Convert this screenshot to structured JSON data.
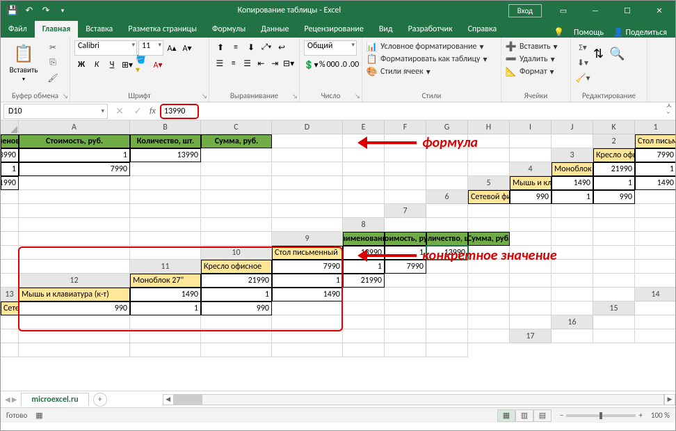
{
  "title": "Копирование таблицы  -  Excel",
  "account": "Вход",
  "tabs": [
    "Файл",
    "Главная",
    "Вставка",
    "Разметка страницы",
    "Формулы",
    "Данные",
    "Рецензирование",
    "Вид",
    "Разработчик",
    "Справка"
  ],
  "help": {
    "help": "Помощь",
    "share": "Поделиться"
  },
  "ribbon": {
    "clipboard": {
      "label": "Буфер обмена",
      "paste": "Вставить"
    },
    "font": {
      "label": "Шрифт",
      "name": "Calibri",
      "size": "11",
      "bold": "Ж",
      "italic": "К",
      "underline": "Ч"
    },
    "align": {
      "label": "Выравнивание"
    },
    "number": {
      "label": "Число",
      "format": "Общий"
    },
    "styles": {
      "label": "Стили",
      "cond": "Условное форматирование",
      "table": "Форматировать как таблицу",
      "cell": "Стили ячеек"
    },
    "cells": {
      "label": "Ячейки",
      "insert": "Вставить",
      "delete": "Удалить",
      "format": "Формат"
    },
    "edit": {
      "label": "Редактирование"
    }
  },
  "name_box": "D10",
  "formula_value": "13990",
  "columns": [
    "A",
    "B",
    "C",
    "D",
    "E",
    "F",
    "G",
    "H",
    "I",
    "J",
    "K"
  ],
  "rows": [
    "1",
    "2",
    "3",
    "4",
    "5",
    "6",
    "7",
    "8",
    "9",
    "10",
    "11",
    "12",
    "13",
    "14",
    "15",
    "16",
    "17"
  ],
  "headers": {
    "name": "Наименование",
    "cost": "Стоимость, руб.",
    "qty": "Количество, шт.",
    "sum": "Сумма, руб."
  },
  "data": [
    {
      "name": "Стол письменный",
      "cost": "13990",
      "qty": "1",
      "sum": "13990"
    },
    {
      "name": "Кресло офисное",
      "cost": "7990",
      "qty": "1",
      "sum": "7990"
    },
    {
      "name": "Моноблок 27\"",
      "cost": "21990",
      "qty": "1",
      "sum": "21990"
    },
    {
      "name": "Мышь и клавиатура (к-т)",
      "cost": "1490",
      "qty": "1",
      "sum": "1490"
    },
    {
      "name": "Сетевой фильтр",
      "cost": "990",
      "qty": "1",
      "sum": "990"
    }
  ],
  "annot": {
    "formula": "формула",
    "value": "конкретное значение"
  },
  "sheet": "microexcel.ru",
  "status": "Готово",
  "zoom": "100 %"
}
